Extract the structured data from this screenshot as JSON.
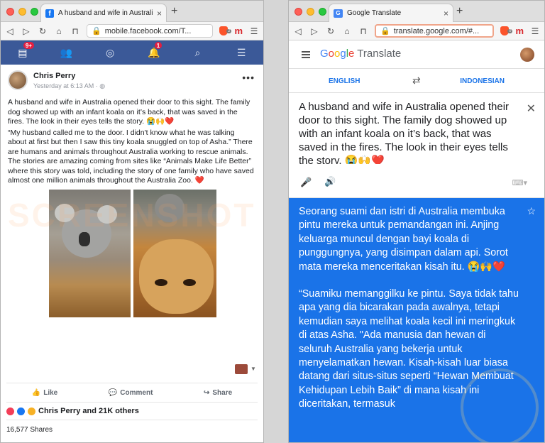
{
  "fb": {
    "tab_title": "A husband and wife in Australia op",
    "url": "mobile.facebook.com/T...",
    "brave_count": "2",
    "nav_badge_messages": "9+",
    "nav_badge_notifications": "1",
    "author": "Chris Perry",
    "timestamp": "Yesterday at 6:13 AM",
    "paragraphs": [
      "A husband and wife in Australia opened their door to this sight. The family dog showed up with an infant koala on it’s back, that was saved in the fires. The look in their eyes tells the story. 😭🙌❤️",
      "“My husband called me to the door. I didn't know what he was talking about at first but then I saw this tiny koala snuggled on top of Asha.” There are humans and animals throughout Australia working to rescue animals. The stories are amazing coming from sites like “Animals Make Life Better” where this story was told, including the story of one family who have saved almost one million animals throughout the Australia Zoo. ❤️"
    ],
    "actions": {
      "like": "Like",
      "comment": "Comment",
      "share": "Share"
    },
    "reactions_text": "Chris Perry and 21K others",
    "shares_text": "16,577 Shares"
  },
  "gt": {
    "tab_title": "Google Translate",
    "url": "translate.google.com/#...",
    "brave_count": "0",
    "logo_google": "Google",
    "logo_product": "Translate",
    "source_lang": "ENGLISH",
    "target_lang": "INDONESIAN",
    "source_text": "A husband and wife in Australia opened their door to this sight. The family dog showed up with an infant koala on it’s back, that was saved in the fires. The look in their eyes tells the story. 😭🙌❤️",
    "target_paragraphs": [
      "Seorang suami dan istri di Australia membuka pintu mereka untuk pemandangan ini. Anjing keluarga muncul dengan bayi koala di punggungnya, yang disimpan dalam api. Sorot mata mereka menceritakan kisah itu. 😭🙌❤️",
      "“Suamiku memanggilku ke pintu. Saya tidak tahu apa yang dia bicarakan pada awalnya, tetapi kemudian saya melihat koala kecil ini meringkuk di atas Asha. \"Ada manusia dan hewan di seluruh Australia yang bekerja untuk menyelamatkan hewan. Kisah-kisah luar biasa datang dari situs-situs seperti “Hewan Membuat Kehidupan Lebih Baik” di mana kisah ini diceritakan, termasuk"
    ]
  },
  "colors": {
    "fb_blue": "#3b5998",
    "gt_blue": "#1a73e8"
  }
}
